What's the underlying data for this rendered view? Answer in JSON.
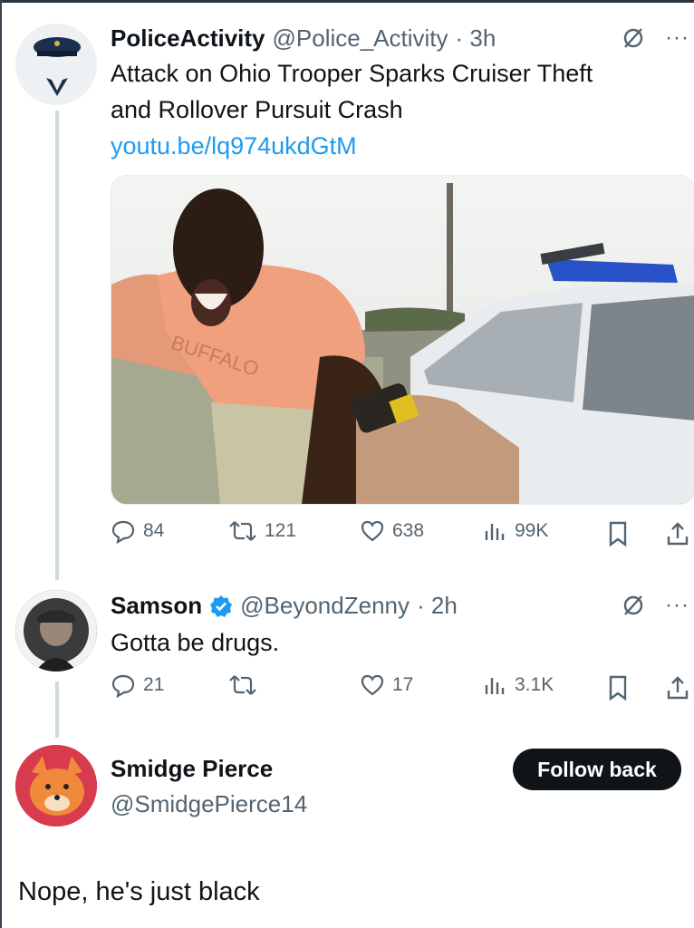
{
  "tweet": {
    "name": "PoliceActivity",
    "handle": "@Police_Activity",
    "time": "· 3h",
    "text_line1": "Attack on Ohio Trooper Sparks Cruiser Theft",
    "text_line2": "and Rollover Pursuit Crash",
    "link": "youtu.be/lq974ukdGtM",
    "shirt_text": "BUFFALO",
    "stats": {
      "replies": "84",
      "retweets": "121",
      "likes": "638",
      "views": "99K"
    }
  },
  "reply": {
    "name": "Samson",
    "handle": "@BeyondZenny",
    "time": "· 2h",
    "text": "Gotta be drugs.",
    "stats": {
      "replies": "21",
      "retweets": "",
      "likes": "17",
      "views": "3.1K"
    }
  },
  "composer": {
    "name": "Smidge Pierce",
    "handle": "@SmidgePierce14",
    "follow_label": "Follow back",
    "text": "Nope, he's just black"
  },
  "more_label": "···",
  "colors": {
    "link": "#1d9bf0",
    "muted": "#536471",
    "verified": "#1d9bf0",
    "button": "#0f1419"
  },
  "icons": [
    "grok-icon",
    "more-icon",
    "reply-icon",
    "retweet-icon",
    "like-icon",
    "views-icon",
    "bookmark-icon",
    "share-icon",
    "verified-badge-icon"
  ]
}
